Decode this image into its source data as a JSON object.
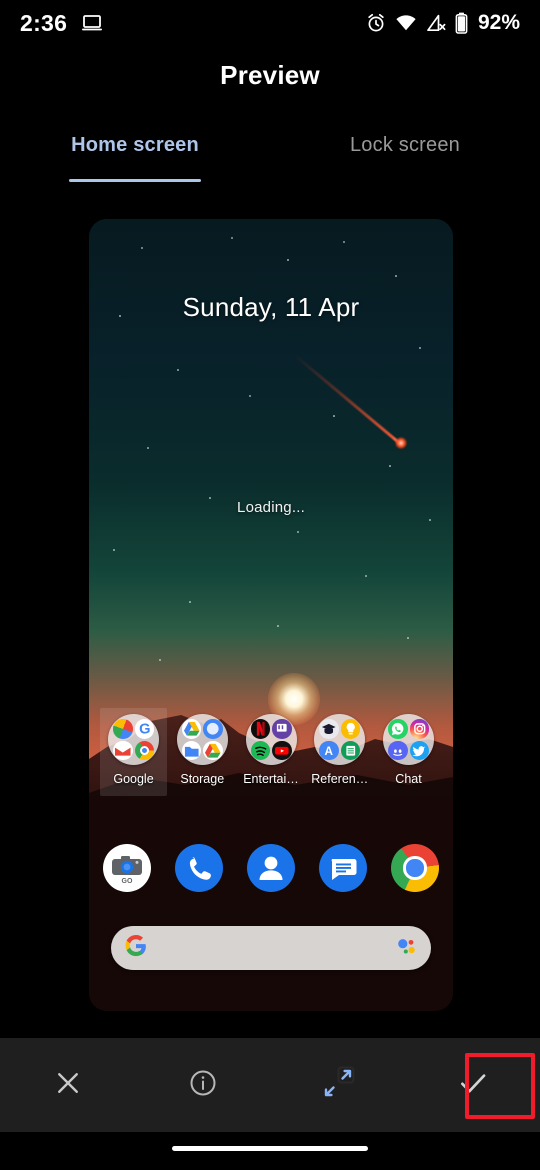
{
  "status_bar": {
    "time": "2:36",
    "battery_percent": "92%",
    "icons": [
      "laptop-cast-icon",
      "alarm-clock-icon",
      "wifi-icon",
      "mobile-data-off-icon",
      "battery-icon"
    ]
  },
  "header": {
    "title": "Preview"
  },
  "tabs": [
    {
      "label": "Home screen",
      "active": true
    },
    {
      "label": "Lock screen",
      "active": false
    }
  ],
  "preview": {
    "wallpaper_name": "meteor-desert-sunset-wallpaper",
    "date_text": "Sunday, 11 Apr",
    "loading_text": "Loading...",
    "folders": [
      {
        "label": "Google",
        "selected": true,
        "apps": [
          "play-store-icon",
          "google-search-icon",
          "gmail-icon",
          "chrome-icon"
        ]
      },
      {
        "label": "Storage",
        "selected": false,
        "apps": [
          "drive-icon",
          "photos-icon",
          "files-icon",
          "drive-backup-icon"
        ]
      },
      {
        "label": "Entertai…",
        "selected": false,
        "apps": [
          "netflix-icon",
          "twitch-icon",
          "spotify-icon",
          "youtube-icon"
        ]
      },
      {
        "label": "Referen…",
        "selected": false,
        "apps": [
          "classroom-icon",
          "keep-icon",
          "translate-icon",
          "sheets-icon"
        ]
      },
      {
        "label": "Chat",
        "selected": false,
        "apps": [
          "whatsapp-icon",
          "instagram-icon",
          "discord-icon",
          "twitter-icon"
        ]
      }
    ],
    "dock": [
      {
        "name": "camera-go-icon",
        "label": "GO"
      },
      {
        "name": "phone-icon",
        "label": ""
      },
      {
        "name": "contacts-icon",
        "label": ""
      },
      {
        "name": "messages-icon",
        "label": ""
      },
      {
        "name": "chrome-icon",
        "label": ""
      }
    ],
    "search_bar": {
      "left_icon": "google-g-icon",
      "right_icon": "google-assistant-icon",
      "value": "",
      "placeholder": ""
    }
  },
  "toolbar": {
    "buttons": [
      {
        "name": "close-button",
        "icon": "close-icon",
        "highlighted": false
      },
      {
        "name": "info-button",
        "icon": "info-icon",
        "highlighted": false
      },
      {
        "name": "scale-button",
        "icon": "expand-arrows-icon",
        "highlighted": false
      },
      {
        "name": "apply-button",
        "icon": "check-icon",
        "highlighted": true
      }
    ]
  },
  "colors": {
    "accent_blue": "#aec5ea",
    "highlight_red": "#f01c2c",
    "toolbar_bg": "#1f1f1f",
    "expand_icon_blue": "#8ab4f8",
    "search_bar_bg": "#d6d3d1"
  }
}
